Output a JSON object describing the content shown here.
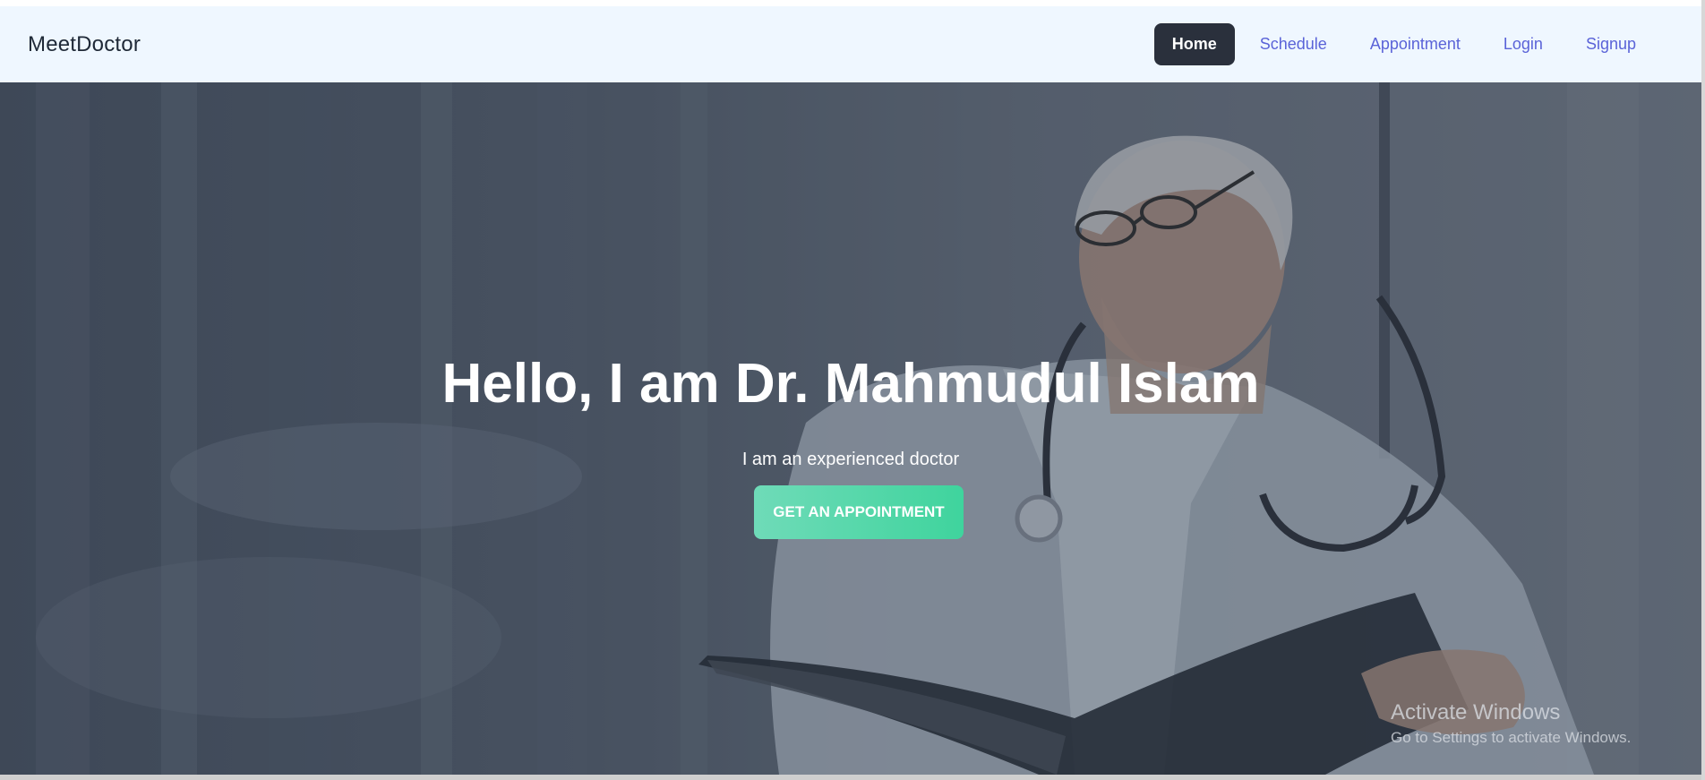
{
  "navbar": {
    "brand": "MeetDoctor",
    "links": [
      {
        "label": "Home",
        "active": true
      },
      {
        "label": "Schedule",
        "active": false
      },
      {
        "label": "Appointment",
        "active": false
      },
      {
        "label": "Login",
        "active": false
      },
      {
        "label": "Signup",
        "active": false
      }
    ]
  },
  "hero": {
    "title": "Hello, I am Dr. Mahmudul Islam",
    "subtitle": "I am an experienced doctor",
    "cta_label": "GET AN APPOINTMENT",
    "background_image": "doctor-reading-book-photo"
  },
  "os_watermark": {
    "title": "Activate Windows",
    "subtitle": "Go to Settings to activate Windows."
  },
  "colors": {
    "navbar_bg": "#eff7ff",
    "nav_link": "#5a63d8",
    "nav_active_bg": "#2a303c",
    "cta_start": "#6fdbb8",
    "cta_end": "#3fd49d"
  }
}
